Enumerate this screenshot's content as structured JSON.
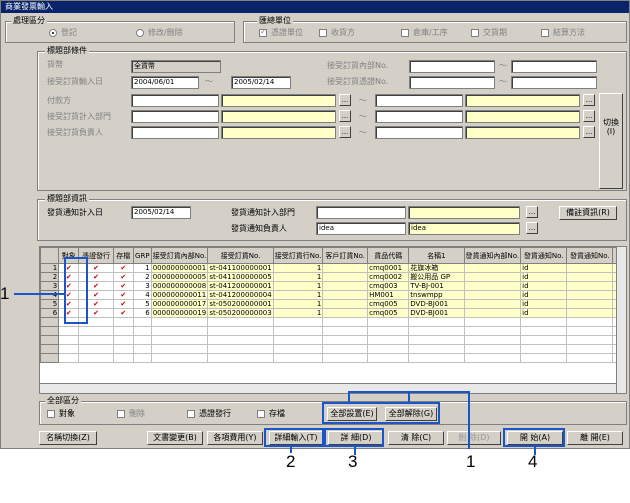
{
  "window": {
    "title": "商業發票輸入"
  },
  "processing": {
    "title": "處理區分",
    "options": [
      "登記",
      "修改/刪除"
    ],
    "selected": "登記"
  },
  "aggregate": {
    "title": "匯總單位",
    "options": [
      "憑證單位",
      "收貨方",
      "倉庫/工序",
      "交貨期",
      "結算方法"
    ],
    "checked": [
      "憑證單位"
    ]
  },
  "header_conditions": {
    "title": "標題部條件",
    "currency_label": "貨幣",
    "currency_value": "全貨幣",
    "date_label": "接受訂貨輸入日",
    "date_from": "2004/06/01",
    "date_sep": "〜",
    "date_to": "2005/02/14",
    "payer_label": "付款方",
    "dept_label": "接受訂貨計入部門",
    "person_label": "接受訂貨負責人",
    "internal_no_label": "接受訂貨內部No.",
    "voucher_no_label": "接受訂貨憑證No.",
    "lookup_btn": "...",
    "toggle_label": "切換(I)"
  },
  "header_info": {
    "title": "標題部資訊",
    "date_label": "發貨通知計入日",
    "date_value": "2005/02/14",
    "dept_label": "發貨通知計入部門",
    "person_label": "發貨通知負責人",
    "person_code": "idea",
    "person_name": "idea",
    "lookup_btn": "...",
    "remark_btn": "備註資訊(R)"
  },
  "table": {
    "columns": [
      "",
      "對象",
      "憑證發行",
      "存檔",
      "GRP",
      "接受訂貨內部No.",
      "接受訂貨No.",
      "接受訂貨行No.",
      "客戶訂貨No.",
      "貨品代碼",
      "名稱1",
      "發貨通知內部No.",
      "發貨通知No.",
      "發貨通知No.",
      "發"
    ],
    "rows": [
      {
        "n": "1",
        "grp": "1",
        "internal": "000000000001",
        "order": "st-041100000001",
        "line": "1",
        "code": "cmq0001",
        "name": "花旗冰箱",
        "ship": "id"
      },
      {
        "n": "2",
        "grp": "2",
        "internal": "000000000005",
        "order": "st-041100000005",
        "line": "1",
        "code": "cmq0002",
        "name": "搬公用品 GP",
        "ship": "id"
      },
      {
        "n": "3",
        "grp": "3",
        "internal": "000000000008",
        "order": "st-041200000001",
        "line": "1",
        "code": "cmq003",
        "name": "TV-BJ-001",
        "ship": "id"
      },
      {
        "n": "4",
        "grp": "4",
        "internal": "000000000011",
        "order": "st-041200000004",
        "line": "1",
        "code": "HM001",
        "name": "tnswmpp",
        "ship": "id"
      },
      {
        "n": "5",
        "grp": "5",
        "internal": "000000000017",
        "order": "st-050200000001",
        "line": "1",
        "code": "cmq005",
        "name": "DVD-BJ001",
        "ship": "id"
      },
      {
        "n": "6",
        "grp": "6",
        "internal": "000000000019",
        "order": "st-050200000003",
        "line": "1",
        "code": "cmq005",
        "name": "DVD-BJ001",
        "ship": "id"
      }
    ]
  },
  "all_div": {
    "title": "全部區分",
    "checks": [
      "對象",
      "刪除",
      "憑證發行",
      "存檔"
    ],
    "select_all": "全部設置(E)",
    "clear_all": "全部解除(G)"
  },
  "toolbar": {
    "name_switch": "名稱切換(Z)",
    "doc_change": "文書變更(B)",
    "expenses": "各項費用(Y)",
    "detail_input": "詳細輸入(T)",
    "detail": "詳 細(D)",
    "clear": "清 除(C)",
    "delete": "刪 除(D)",
    "start": "開 始(A)",
    "close": "離 開(E)"
  },
  "callouts": [
    "1",
    "1",
    "2",
    "3",
    "4"
  ],
  "colors": {
    "highlight": "#1a56c8",
    "window": "#d4d0c8",
    "title_bar": "#0a246a",
    "input_yellow": "#ffffc8"
  }
}
